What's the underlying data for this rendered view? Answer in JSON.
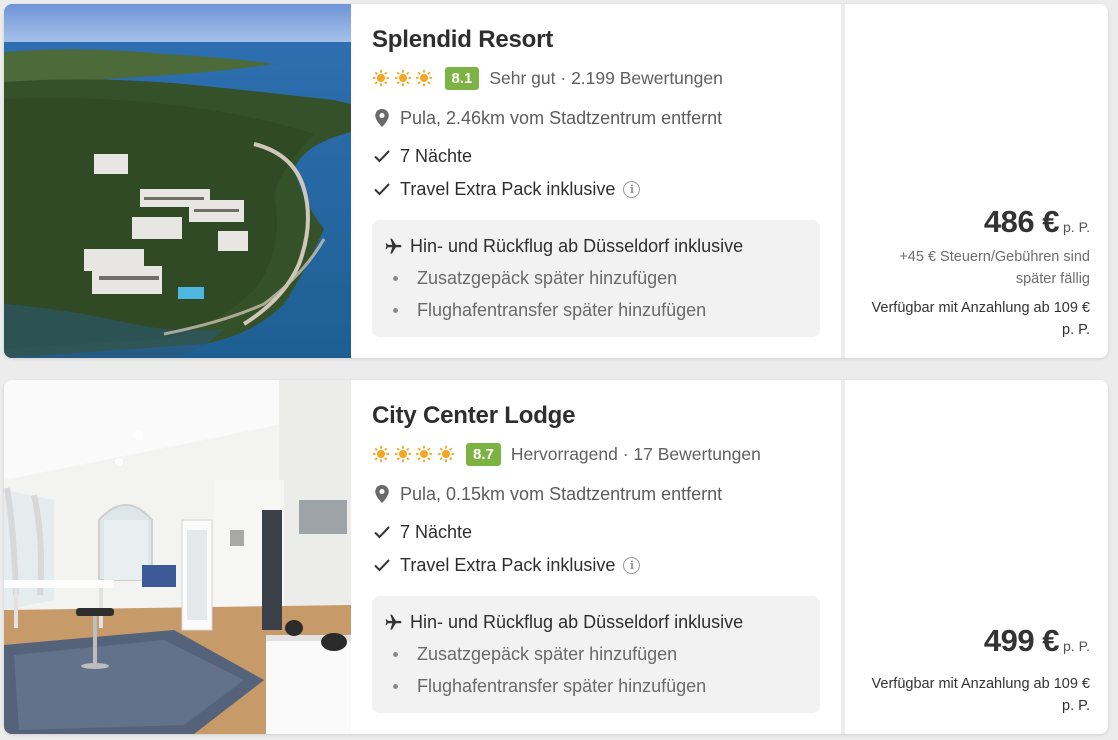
{
  "results": [
    {
      "name": "Splendid Resort",
      "stars": 3,
      "score": "8.1",
      "rating_label": "Sehr gut · 2.199 Bewertungen",
      "location": "Pula, 2.46km vom Stadtzentrum entfernt",
      "features": [
        "7 Nächte",
        "Travel Extra Pack inklusive"
      ],
      "flight": "Hin- und Rückflug ab Düsseldorf inklusive",
      "extras": [
        "Zusatzgepäck später hinzufügen",
        "Flughafentransfer später hinzufügen"
      ],
      "price": "486 €",
      "price_unit": "p. P.",
      "fees": "+45 € Steuern/Gebühren sind später fällig",
      "deposit": "Verfügbar mit Anzahlung ab 109 € p. P."
    },
    {
      "name": "City Center Lodge",
      "stars": 4,
      "score": "8.7",
      "rating_label": "Hervorragend · 17 Bewertungen",
      "location": "Pula, 0.15km vom Stadtzentrum entfernt",
      "features": [
        "7 Nächte",
        "Travel Extra Pack inklusive"
      ],
      "flight": "Hin- und Rückflug ab Düsseldorf inklusive",
      "extras": [
        "Zusatzgepäck später hinzufügen",
        "Flughafentransfer später hinzufügen"
      ],
      "price": "499 €",
      "price_unit": "p. P.",
      "deposit": "Verfügbar mit Anzahlung ab 109 € p. P."
    }
  ],
  "colors": {
    "score_badge": "#7cb342",
    "sun": "#f5a623",
    "card_bg": "#ffffff",
    "page_bg": "#ececec",
    "flight_box_bg": "#f2f2f2"
  },
  "icons": {
    "star": "sun-icon",
    "location": "map-pin-icon",
    "feature": "check-icon",
    "info": "info-icon",
    "flight": "airplane-icon",
    "extra": "bullet-dot"
  }
}
